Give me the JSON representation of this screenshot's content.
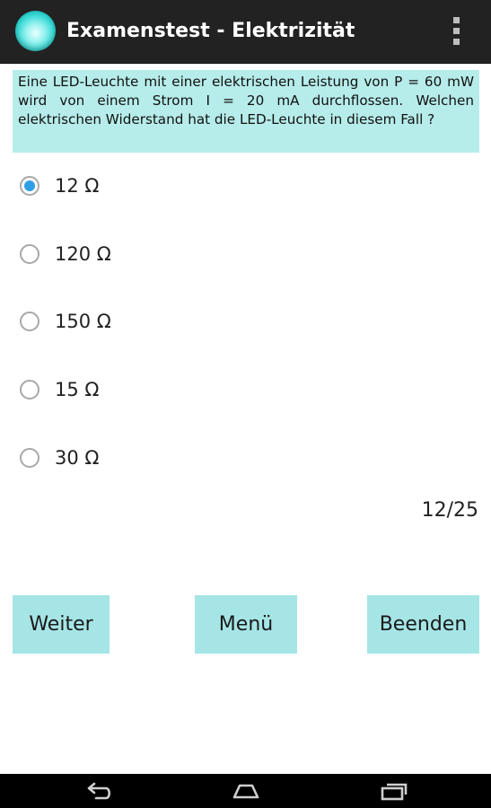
{
  "header": {
    "title": "Examenstest - Elektrizität",
    "app_icon": "app-bulb-icon",
    "menu_icon": "overflow-menu-icon"
  },
  "question": {
    "text": "Eine LED-Leuchte mit einer elektrischen Leistung von P = 60 mW wird von einem Strom I = 20 mA durchflos­sen. Welchen elektrischen Widerstand hat die LED-Leuchte in diesem Fall ?"
  },
  "options": [
    {
      "label": "12 Ω",
      "selected": true
    },
    {
      "label": "120 Ω",
      "selected": false
    },
    {
      "label": "150 Ω",
      "selected": false
    },
    {
      "label": "15 Ω",
      "selected": false
    },
    {
      "label": "30 Ω",
      "selected": false
    }
  ],
  "progress": {
    "counter": "12/25"
  },
  "buttons": {
    "next_label": "Weiter",
    "menu_label": "Menü",
    "quit_label": "Beenden"
  },
  "navigation": {
    "back_icon": "back-icon",
    "home_icon": "home-icon",
    "recents_icon": "recent-apps-icon"
  },
  "colors": {
    "action_bar": "#222222",
    "question_bg": "#b6ecea",
    "button_bg": "#a6e5e6",
    "radio_accent": "#2e9fe6",
    "nav_bar": "#000000"
  }
}
